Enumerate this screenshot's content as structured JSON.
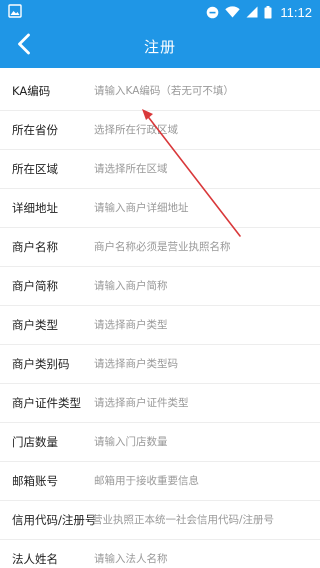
{
  "status_bar": {
    "time": "11:12",
    "notification_icon": "image-notification-icon",
    "icons": [
      "circle-notification-icon",
      "wifi-icon",
      "cell-signal-icon",
      "battery-icon"
    ]
  },
  "header": {
    "title": "注册",
    "back_icon": "chevron-left-icon"
  },
  "form": {
    "fields": [
      {
        "label": "KA编码",
        "placeholder": "请输入KA编码（若无可不填）",
        "value": ""
      },
      {
        "label": "所在省份",
        "placeholder": "选择所在行政区域",
        "value": ""
      },
      {
        "label": "所在区域",
        "placeholder": "请选择所在区域",
        "value": ""
      },
      {
        "label": "详细地址",
        "placeholder": "请输入商户详细地址",
        "value": ""
      },
      {
        "label": "商户名称",
        "placeholder": "商户名称必须是营业执照名称",
        "value": ""
      },
      {
        "label": "商户简称",
        "placeholder": "请输入商户简称",
        "value": ""
      },
      {
        "label": "商户类型",
        "placeholder": "请选择商户类型",
        "value": ""
      },
      {
        "label": "商户类别码",
        "placeholder": "请选择商户类型码",
        "value": ""
      },
      {
        "label": "商户证件类型",
        "placeholder": "请选择商户证件类型",
        "value": ""
      },
      {
        "label": "门店数量",
        "placeholder": "请输入门店数量",
        "value": ""
      },
      {
        "label": "邮箱账号",
        "placeholder": "邮箱用于接收重要信息",
        "value": ""
      },
      {
        "label": "信用代码/注册号",
        "placeholder": "营业执照正本统一社会信用代码/注册号",
        "value": ""
      },
      {
        "label": "法人姓名",
        "placeholder": "请输入法人名称",
        "value": ""
      }
    ]
  },
  "colors": {
    "accent": "#1f96e6",
    "annotation_arrow": "#d9383a"
  }
}
